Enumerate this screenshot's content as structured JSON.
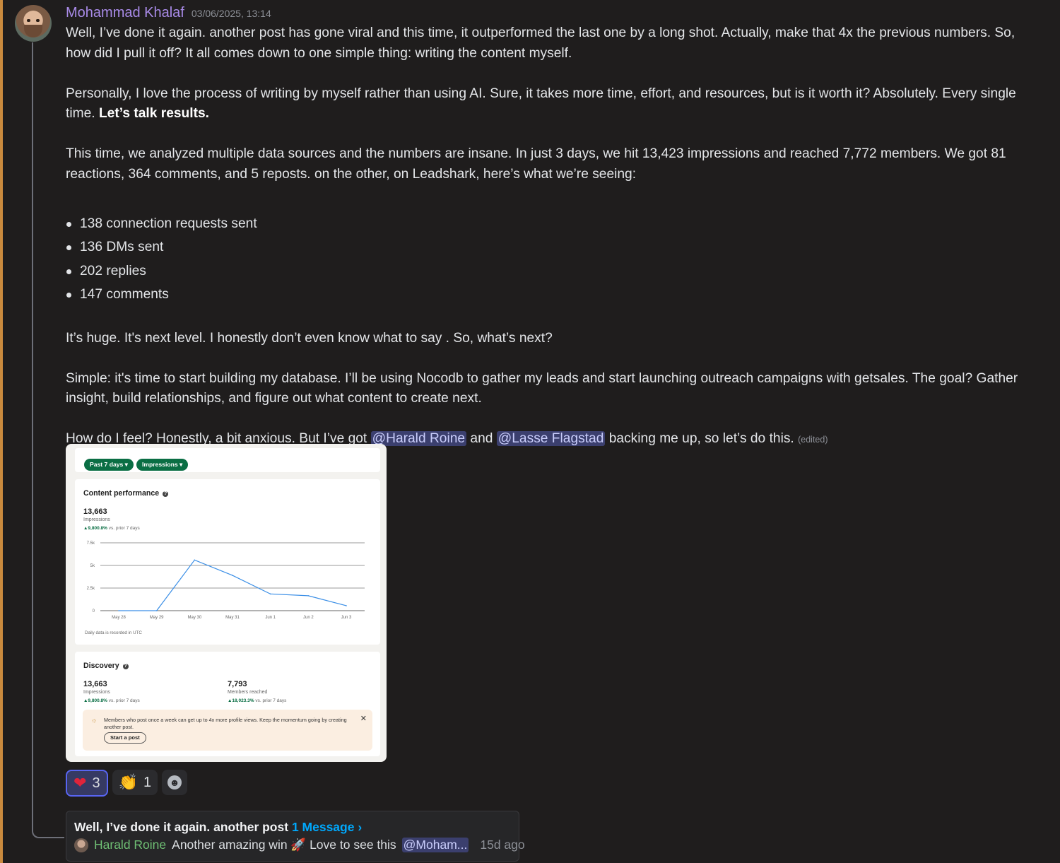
{
  "message": {
    "author": "Mohammad Khalaf",
    "timestamp": "03/06/2025, 13:14",
    "p1": "Well, I’ve done it again. another post has gone viral and this time, it outperformed the last one by a long shot. Actually, make that 4x the previous numbers. So, how did I pull it off? It all comes down to one simple thing: writing the content myself.",
    "p2": "Personally, I love the process of writing by myself rather than using AI. Sure, it takes more time, effort, and resources, but is it worth it? Absolutely. Every single time.",
    "p2_bold": "Let’s talk results.",
    "p3": "This time, we analyzed multiple data sources and the numbers are insane. In just 3 days, we hit 13,423 impressions and reached 7,772 members. We got 81 reactions, 364 comments, and 5 reposts. on the other,  on Leadshark, here’s what we’re seeing:",
    "bullets": [
      "138 connection requests sent",
      "136 DMs sent",
      "202 replies",
      "147 comments"
    ],
    "p4": "It’s huge. It's next level. I honestly don’t even know what to say . So, what’s next?",
    "p5": "Simple: it's time to start building my database. I’ll be using Nocodb to gather my leads and start launching outreach campaigns with getsales. The goal? Gather insight, build relationships, and figure out what content to create next.",
    "p6_start": "How do I feel? Honestly, a bit anxious. But I’ve got",
    "mention1": "@Harald Roine",
    "p6_and": "and",
    "mention2": "@Lasse Flagstad",
    "p6_end": "backing me up, so let’s do this.",
    "edited": "(edited)"
  },
  "screenshot": {
    "filter1": "Past 7 days ▾",
    "filter2": "Impressions ▾",
    "perf_title": "Content performance",
    "perf_value": "13,663",
    "perf_label": "Impressions",
    "perf_delta": "▲9,800.8%",
    "perf_delta_suffix": "vs. prior 7 days",
    "chart_note": "Daily data is recorded in UTC",
    "discovery_title": "Discovery",
    "disc_impr_value": "13,663",
    "disc_impr_label": "Impressions",
    "disc_impr_delta": "▲9,800.8%",
    "disc_reach_value": "7,793",
    "disc_reach_label": "Members reached",
    "disc_reach_delta": "▲18,023.3%",
    "delta_suffix": "vs. prior 7 days",
    "notice": "Members who post once a week can get up to 4x more profile views. Keep the momentum going by creating another post.",
    "notice_button": "Start a post",
    "notice_close": "✕",
    "notice_icon": "☼"
  },
  "chart_data": {
    "type": "line",
    "categories": [
      "May 28",
      "May 29",
      "May 30",
      "May 31",
      "Jun 1",
      "Jun 2",
      "Jun 3"
    ],
    "values": [
      0,
      0,
      5600,
      3900,
      1850,
      1650,
      550
    ],
    "ylim": [
      0,
      7500
    ],
    "yticks": [
      "0",
      "2.5k",
      "5k",
      "7.5k"
    ],
    "grid": true,
    "line_color": "#3a8ee6"
  },
  "reactions": [
    {
      "emoji": "❤",
      "count": "3",
      "me": true
    },
    {
      "emoji": "👏",
      "count": "1",
      "me": false
    }
  ],
  "add_reaction_icon": "☻",
  "thread": {
    "title": "Well, I’ve done it again. another post",
    "count": "1 Message ›",
    "last_author": "Harald Roine",
    "last_text": "Another amazing win 🚀 Love to see this",
    "last_mention": "@Moham...",
    "ago": "15d ago"
  }
}
